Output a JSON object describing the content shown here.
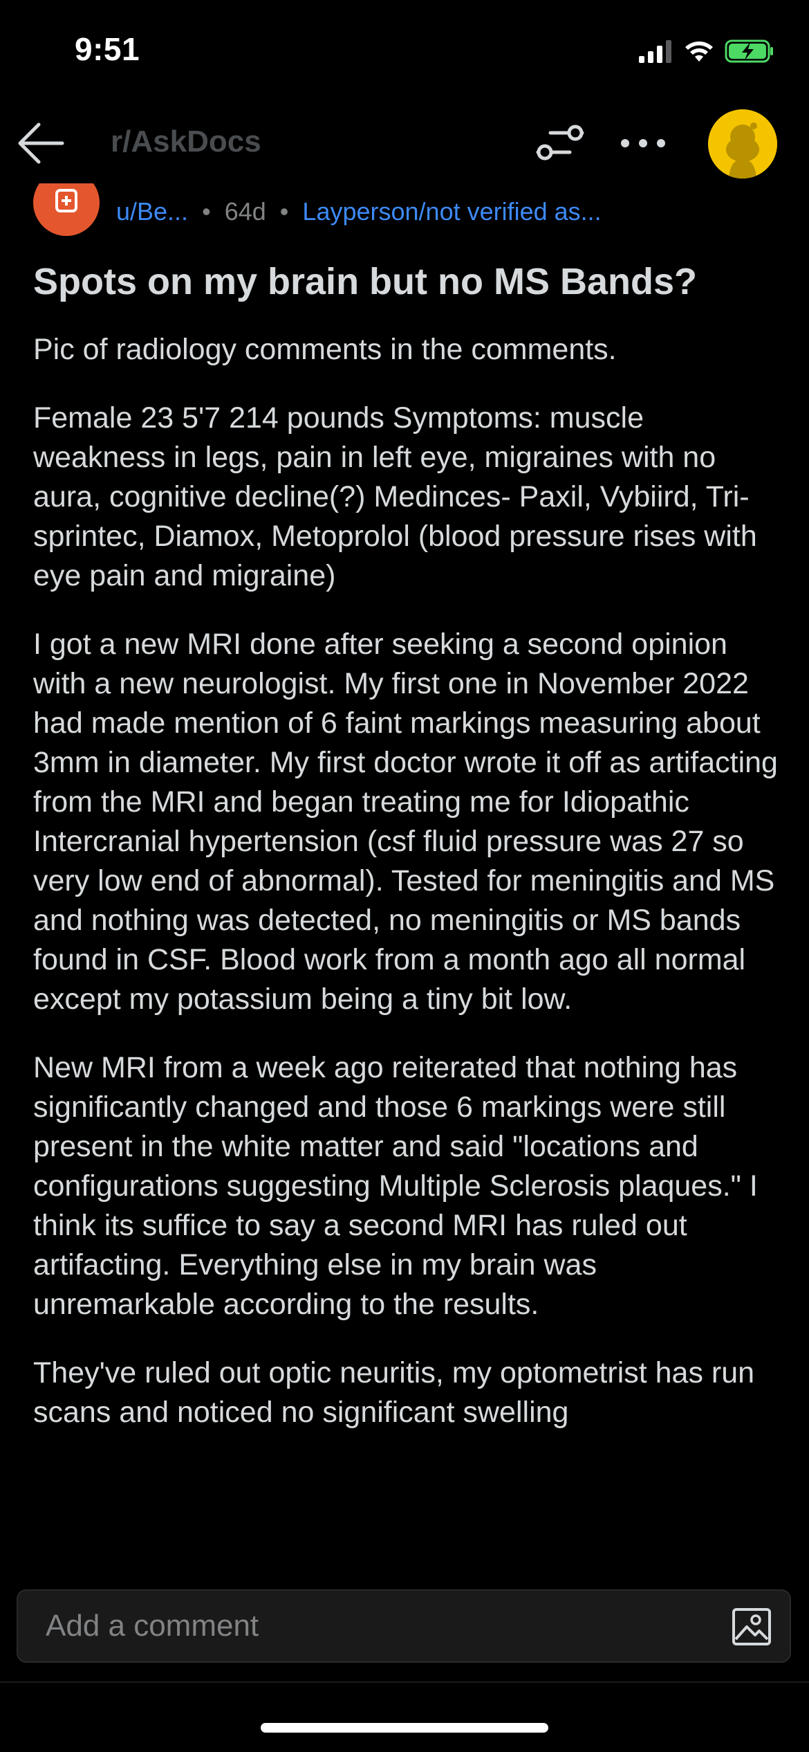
{
  "status_bar": {
    "time": "9:51"
  },
  "nav": {
    "subreddit": "r/AskDocs"
  },
  "post": {
    "author": "u/Be...",
    "age": "64d",
    "flair": "Layperson/not verified as...",
    "title": "Spots on my brain but no MS Bands?",
    "paragraphs": [
      "Pic of radiology comments in the comments.",
      "Female 23 5'7 214 pounds Symptoms: muscle weakness in legs, pain in left eye, migraines with no aura, cognitive decline(?) Medinces- Paxil, Vybiird, Tri-sprintec, Diamox, Metoprolol (blood pressure rises with eye pain and migraine)",
      "I got a new MRI done after seeking a second opinion with a new neurologist. My first one in November 2022 had made mention of 6 faint markings measuring about 3mm in diameter. My first doctor wrote it off as artifacting from the MRI and began treating me for Idiopathic Intercranial hypertension (csf fluid pressure was 27 so very low end of abnormal). Tested for meningitis and MS and nothing was detected, no meningitis or MS bands found in CSF. Blood work from a month ago all normal except my potassium being a tiny bit low.",
      "New MRI from a week ago reiterated that nothing has significantly changed and those 6 markings were still present in the white matter and said \"locations and configurations suggesting Multiple Sclerosis plaques.\" I think its suffice to say a second MRI has ruled out artifacting. Everything else in my brain was unremarkable according to the results.",
      "They've ruled out optic neuritis, my optometrist has run scans and noticed no significant swelling"
    ]
  },
  "comment_bar": {
    "placeholder": "Add a comment"
  },
  "colors": {
    "background": "#000000",
    "text": "#d7dadc",
    "link": "#3d8af7",
    "muted": "#818384",
    "avatar_yellow": "#f5c400",
    "author_avatar": "#e4572e",
    "battery_green": "#4cd964"
  },
  "icons": {
    "back": "arrow-left-icon",
    "filter": "sliders-icon",
    "more": "ellipsis-icon",
    "image": "image-icon",
    "signal": "signal-icon",
    "wifi": "wifi-icon",
    "battery": "battery-charging-icon"
  }
}
